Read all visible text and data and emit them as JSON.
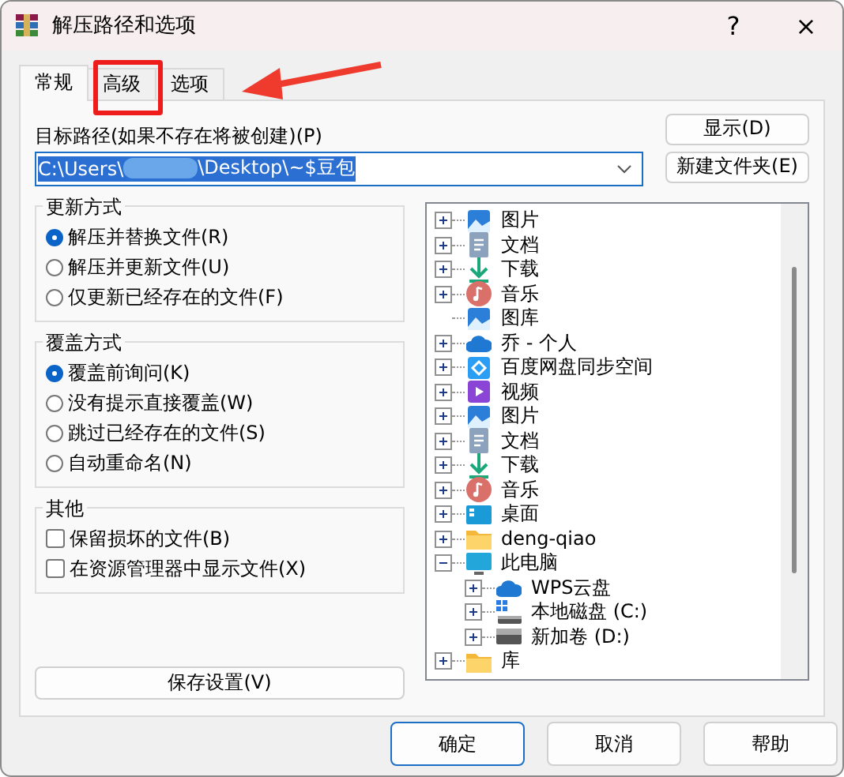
{
  "window": {
    "title": "解压路径和选项",
    "help": "?",
    "close": "×"
  },
  "tabs": [
    {
      "label": "常规",
      "selected": true
    },
    {
      "label": "高级",
      "selected": false
    },
    {
      "label": "选项",
      "selected": false
    }
  ],
  "destination": {
    "label": "目标路径(如果不存在将被创建)(P)",
    "value_start": "C:\\Users\\",
    "value_end": "\\Desktop\\~$豆包",
    "selected": true
  },
  "side_buttons": [
    "显示(D)",
    "新建文件夹(E)"
  ],
  "groups": [
    {
      "title": "更新方式",
      "kind": "radio",
      "options": [
        {
          "label": "解压并替换文件(R)",
          "selected": true
        },
        {
          "label": "解压并更新文件(U)",
          "selected": false
        },
        {
          "label": "仅更新已经存在的文件(F)",
          "selected": false
        }
      ]
    },
    {
      "title": "覆盖方式",
      "kind": "radio",
      "options": [
        {
          "label": "覆盖前询问(K)",
          "selected": true
        },
        {
          "label": "没有提示直接覆盖(W)",
          "selected": false
        },
        {
          "label": "跳过已经存在的文件(S)",
          "selected": false
        },
        {
          "label": "自动重命名(N)",
          "selected": false
        }
      ]
    },
    {
      "title": "其他",
      "kind": "checkbox",
      "options": [
        {
          "label": "保留损坏的文件(B)",
          "checked": false
        },
        {
          "label": "在资源管理器中显示文件(X)",
          "checked": false
        }
      ]
    }
  ],
  "save_button": "保存设置(V)",
  "tree": [
    {
      "label": "图片",
      "kind": "pictures",
      "expandable": true,
      "expanded": false
    },
    {
      "label": "文档",
      "kind": "documents",
      "expandable": true,
      "expanded": false
    },
    {
      "label": "下载",
      "kind": "downloads",
      "expandable": true,
      "expanded": false
    },
    {
      "label": "音乐",
      "kind": "music",
      "expandable": true,
      "expanded": false
    },
    {
      "label": "图库",
      "kind": "pictures",
      "expandable": false
    },
    {
      "label": "乔 - 个人",
      "kind": "cloud",
      "expandable": true,
      "expanded": false
    },
    {
      "label": "百度网盘同步空间",
      "kind": "sync",
      "expandable": true,
      "expanded": false
    },
    {
      "label": "视频",
      "kind": "video",
      "expandable": true,
      "expanded": false
    },
    {
      "label": "图片",
      "kind": "pictures",
      "expandable": true,
      "expanded": false
    },
    {
      "label": "文档",
      "kind": "documents",
      "expandable": true,
      "expanded": false
    },
    {
      "label": "下载",
      "kind": "downloads",
      "expandable": true,
      "expanded": false
    },
    {
      "label": "音乐",
      "kind": "music",
      "expandable": true,
      "expanded": false
    },
    {
      "label": "桌面",
      "kind": "desktop",
      "expandable": true,
      "expanded": false
    },
    {
      "label": "deng-qiao",
      "kind": "folder",
      "expandable": true,
      "expanded": false
    },
    {
      "label": "此电脑",
      "kind": "computer",
      "expandable": true,
      "expanded": true,
      "children": [
        {
          "label": "WPS云盘",
          "kind": "cloud",
          "expandable": true,
          "expanded": false
        },
        {
          "label": "本地磁盘 (C:)",
          "kind": "system-drive",
          "expandable": true,
          "expanded": false
        },
        {
          "label": "新加卷 (D:)",
          "kind": "drive",
          "expandable": true,
          "expanded": false
        }
      ]
    },
    {
      "label": "库",
      "kind": "folder",
      "expandable": true,
      "expanded": false
    }
  ],
  "footer_buttons": [
    {
      "label": "确定",
      "selected": true
    },
    {
      "label": "取消",
      "selected": false
    },
    {
      "label": "帮助",
      "selected": false
    }
  ]
}
